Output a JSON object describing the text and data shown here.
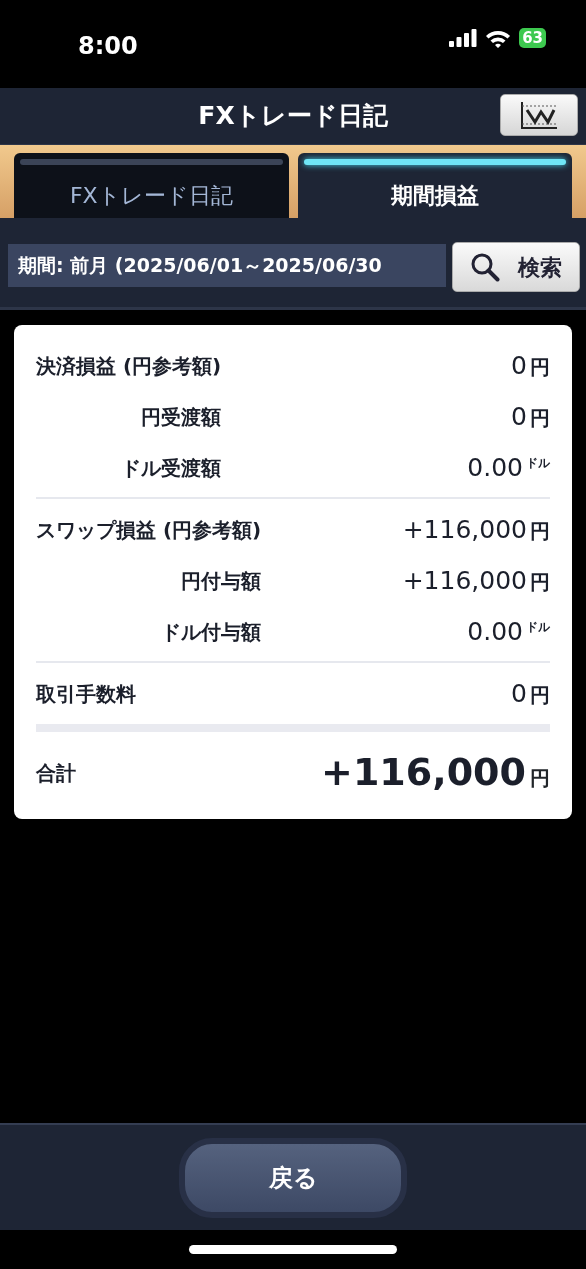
{
  "status_bar": {
    "time": "8:00",
    "battery": "63"
  },
  "header": {
    "title": "FXトレード日記"
  },
  "tabs": [
    {
      "label": "FXトレード日記",
      "selected": false
    },
    {
      "label": "期間損益",
      "selected": true
    }
  ],
  "period": {
    "value": "期間: 前月 (2025/06/01～2025/06/30",
    "search_button": "検索"
  },
  "groups": [
    {
      "rows": [
        {
          "kind": "main",
          "label": "決済損益 (円参考額)",
          "value": "0",
          "unit": "円"
        },
        {
          "kind": "sub",
          "label": "円受渡額",
          "value": "0",
          "unit": "円"
        },
        {
          "kind": "sub",
          "label": "ドル受渡額",
          "value": "0.00",
          "unit": "ドル"
        }
      ]
    },
    {
      "rows": [
        {
          "kind": "main",
          "label": "スワップ損益 (円参考額)",
          "value": "+116,000",
          "unit": "円"
        },
        {
          "kind": "sub",
          "label": "円付与額",
          "value": "+116,000",
          "unit": "円"
        },
        {
          "kind": "sub",
          "label": "ドル付与額",
          "value": "0.00",
          "unit": "ドル"
        }
      ]
    },
    {
      "rows": [
        {
          "kind": "main",
          "label": "取引手数料",
          "value": "0",
          "unit": "円"
        }
      ]
    }
  ],
  "total": {
    "label": "合計",
    "value": "+116,000",
    "unit": "円"
  },
  "back_button": "戻る"
}
